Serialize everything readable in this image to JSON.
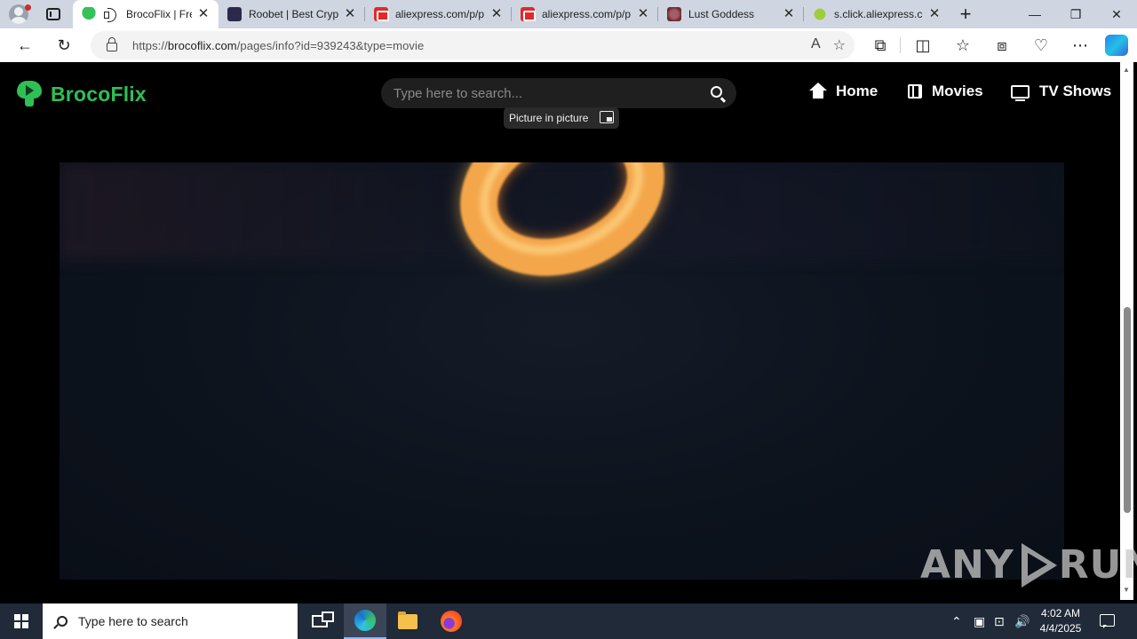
{
  "browser": {
    "tabs": [
      {
        "title": "BrocoFlix | Fre",
        "favicon": "brocoflix-icon",
        "audio": true,
        "active": true
      },
      {
        "title": "Roobet | Best Cryp",
        "favicon": "roobet-icon",
        "active": false
      },
      {
        "title": "aliexpress.com/p/p",
        "favicon": "aliexpress-icon",
        "active": false
      },
      {
        "title": "aliexpress.com/p/p",
        "favicon": "aliexpress-icon",
        "active": false
      },
      {
        "title": "Lust Goddess",
        "favicon": "lust-goddess-icon",
        "active": false
      },
      {
        "title": "s.click.aliexpress.co",
        "favicon": "click-icon",
        "active": false
      }
    ],
    "new_tab_label": "+",
    "window_controls": {
      "minimize": "—",
      "restore": "❐",
      "close": "✕"
    },
    "address": {
      "url_prefix": "https://",
      "url_host": "brocoflix.com",
      "url_path": "/pages/info?id=939243&type=movie"
    }
  },
  "site": {
    "logo_text": "BrocoFlix",
    "brand_color": "#2fbf55",
    "search": {
      "placeholder": "Type here to search..."
    },
    "nav": [
      {
        "label": "Home",
        "icon": "home-icon"
      },
      {
        "label": "Movies",
        "icon": "film-icon"
      },
      {
        "label": "TV Shows",
        "icon": "tv-icon"
      }
    ],
    "pip_tooltip": "Picture in picture"
  },
  "watermark": {
    "left": "ANY",
    "right": "RUN"
  },
  "taskbar": {
    "search_placeholder": "Type here to search",
    "clock_time": "4:02 AM",
    "clock_date": "4/4/2025"
  }
}
